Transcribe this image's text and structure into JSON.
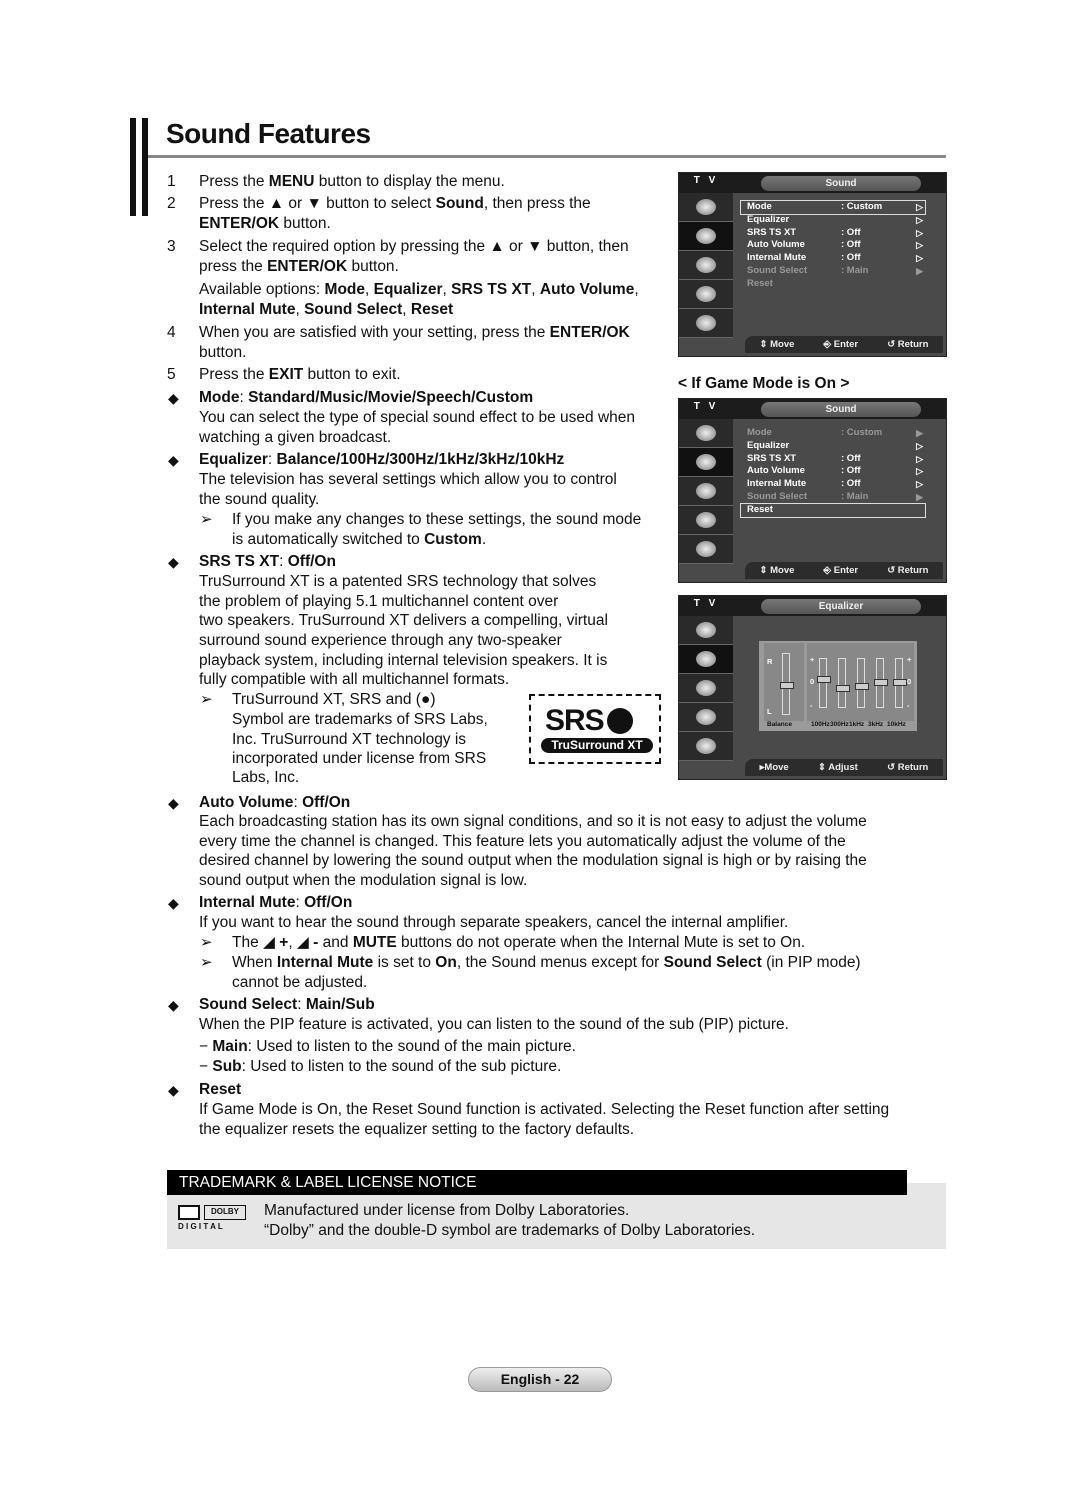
{
  "title": "Sound Features",
  "steps": [
    {
      "num": "1",
      "lines": [
        "Press the **MENU** button to display the menu."
      ]
    },
    {
      "num": "2",
      "lines": [
        "Press the ▲ or ▼ button to select **Sound**, then press the",
        "**ENTER/OK** button."
      ]
    },
    {
      "num": "3",
      "lines": [
        "Select the required option by pressing the ▲ or ▼ button, then",
        "press the **ENTER/OK** button.",
        "Available options: **Mode**, **Equalizer**, **SRS TS XT**, **Auto Volume**,",
        "**Internal Mute**, **Sound Select**, **Reset**"
      ]
    },
    {
      "num": "4",
      "lines": [
        "When you are satisfied with your setting, press the **ENTER/OK**",
        "button."
      ]
    },
    {
      "num": "5",
      "lines": [
        "Press the **EXIT** button to exit."
      ]
    }
  ],
  "sections": [
    {
      "heading": "**Mode**: **Standard/Music/Movie/Speech/Custom**",
      "lines": [
        "You can select the type of special sound effect to be used when",
        "watching a given broadcast."
      ],
      "notes": []
    },
    {
      "heading": "**Equalizer**: **Balance/100Hz/300Hz/1kHz/3kHz/10kHz**",
      "lines": [
        "The television has several settings which allow you to control",
        "the sound quality."
      ],
      "notes": [
        [
          "If you make any changes to these settings, the sound mode",
          "is automatically switched to **Custom**."
        ]
      ]
    },
    {
      "heading": "**SRS TS XT**: **Off/On**",
      "lines": [
        "TruSurround XT is a patented SRS technology that solves",
        "the problem of playing 5.1 multichannel content over",
        "two speakers. TruSurround XT delivers a compelling, virtual",
        "surround sound experience through any two-speaker",
        "playback system, including internal television speakers. It is",
        "fully compatible with all multichannel formats."
      ],
      "notes": [
        [
          "TruSurround XT, SRS and (●)",
          "Symbol are trademarks of SRS Labs,",
          "Inc. TruSurround XT technology is",
          "incorporated under license from SRS",
          "Labs, Inc."
        ]
      ]
    },
    {
      "heading": "**Auto Volume**: **Off/On**",
      "lines": [
        "Each broadcasting station has its own signal conditions, and so it is not easy to adjust the volume",
        "every time the channel is changed. This feature lets you automatically adjust the volume of the",
        "desired channel by lowering the sound output when the modulation signal is high or by raising the",
        "sound output when the modulation signal is low."
      ],
      "notes": []
    },
    {
      "heading": "**Internal Mute**: **Off/On**",
      "lines": [
        "If you want to hear the sound through separate speakers, cancel the internal amplifier."
      ],
      "notes": [
        [
          "The ◢ **+**, ◢ **-** and **MUTE** buttons do not operate when the Internal Mute is set to On."
        ],
        [
          "When **Internal Mute** is set to **On**, the Sound menus except for **Sound Select** (in PIP mode)",
          "cannot be adjusted."
        ]
      ]
    },
    {
      "heading": "**Sound Select**: **Main/Sub**",
      "lines": [
        "When the PIP feature is activated, you can listen to the sound of the sub (PIP) picture.",
        "−  **Main**: Used to listen to the sound of the main picture.",
        "−  **Sub**: Used to listen to the sound of the sub picture."
      ],
      "notes": []
    },
    {
      "heading": "**Reset**",
      "lines": [
        "If Game Mode is On, the Reset Sound function is activated. Selecting the Reset function after setting",
        "the equalizer resets the equalizer setting to the factory defaults."
      ],
      "notes": []
    }
  ],
  "game_mode_label": "< If Game Mode is On >",
  "srs_logo": {
    "text": "SRS",
    "sub": "TruSurround XT"
  },
  "menus": [
    {
      "tv": "T V",
      "title": "Sound",
      "items": [
        {
          "label": "Mode",
          "value": ": Custom",
          "state": "highlight"
        },
        {
          "label": "Equalizer",
          "value": "",
          "state": "normal"
        },
        {
          "label": "SRS TS XT",
          "value": ": Off",
          "state": "normal"
        },
        {
          "label": "Auto Volume",
          "value": ": Off",
          "state": "normal"
        },
        {
          "label": "Internal Mute",
          "value": ": Off",
          "state": "normal"
        },
        {
          "label": "Sound Select",
          "value": ": Main",
          "state": "disabled"
        },
        {
          "label": "Reset",
          "value": "",
          "state": "disabled"
        }
      ],
      "footer": [
        "⇕ Move",
        "⎆ Enter",
        "↺ Return"
      ]
    },
    {
      "tv": "T V",
      "title": "Sound",
      "items": [
        {
          "label": "Mode",
          "value": ": Custom",
          "state": "disabled"
        },
        {
          "label": "Equalizer",
          "value": "",
          "state": "normal"
        },
        {
          "label": "SRS TS XT",
          "value": ": Off",
          "state": "normal"
        },
        {
          "label": "Auto Volume",
          "value": ": Off",
          "state": "normal"
        },
        {
          "label": "Internal Mute",
          "value": ": Off",
          "state": "normal"
        },
        {
          "label": "Sound Select",
          "value": ": Main",
          "state": "disabled"
        },
        {
          "label": "Reset",
          "value": "",
          "state": "highlight"
        }
      ],
      "footer": [
        "⇕ Move",
        "⎆ Enter",
        "↺ Return"
      ]
    },
    {
      "tv": "T V",
      "title": "Equalizer",
      "equalizer": {
        "balance": {
          "label": "Balance",
          "top": "R",
          "bottom": "L",
          "level": 0.5
        },
        "bands": [
          {
            "label": "100Hz",
            "level": 0.62
          },
          {
            "label": "300Hz",
            "level": 0.4
          },
          {
            "label": "1kHz",
            "level": 0.46
          },
          {
            "label": "3kHz",
            "level": 0.55
          },
          {
            "label": "10kHz",
            "level": 0.55
          }
        ],
        "plus": "+",
        "zero": "0",
        "minus": "-"
      },
      "footer": [
        "▸Move",
        "⇕ Adjust",
        "↺ Return"
      ]
    }
  ],
  "notice": {
    "heading": "TRADEMARK & LABEL LICENSE NOTICE",
    "logo": {
      "brand": "DOLBY",
      "sub": "D I G I T A L"
    },
    "lines": [
      "Manufactured under license from Dolby Laboratories.",
      "“Dolby” and the double-D symbol are trademarks of Dolby Laboratories."
    ]
  },
  "footer": {
    "page_label": "English - 22"
  }
}
